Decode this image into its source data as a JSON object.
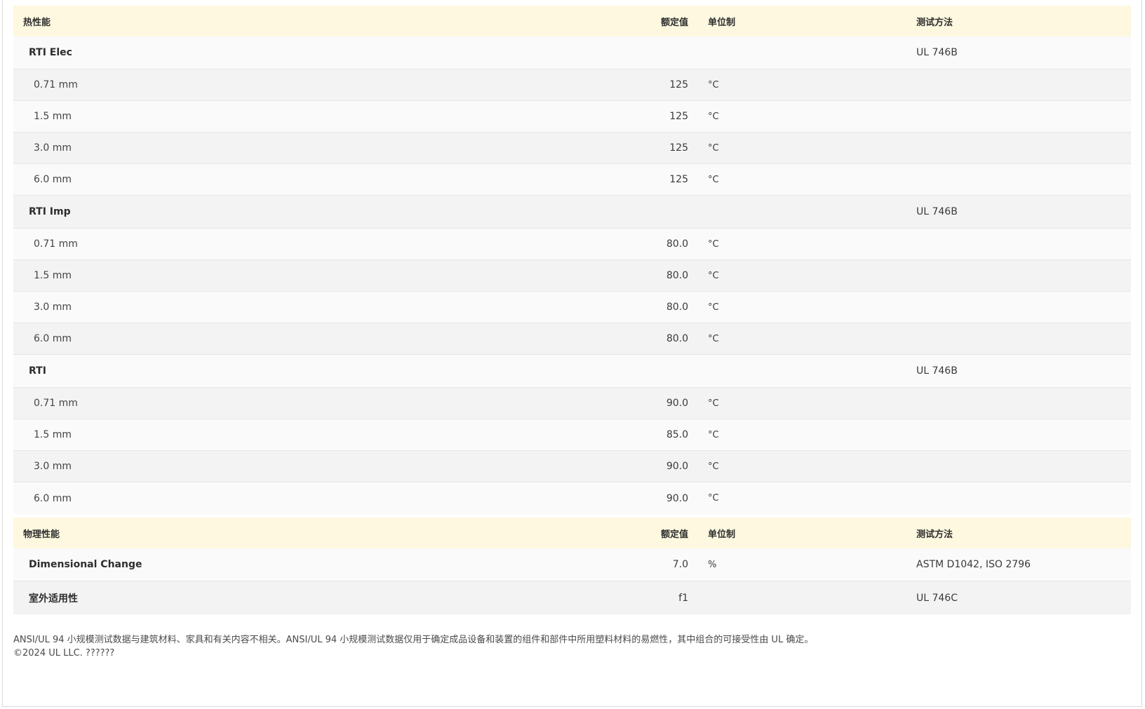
{
  "thermal": {
    "header": {
      "name": "热性能",
      "value": "额定值",
      "unit": "单位制",
      "method": "测试方法"
    },
    "rows": [
      {
        "kind": "group",
        "name": "RTI Elec",
        "value": "",
        "unit": "",
        "method": "UL 746B"
      },
      {
        "kind": "sub",
        "name": "0.71 mm",
        "value": "125",
        "unit": "°C",
        "method": ""
      },
      {
        "kind": "sub",
        "name": "1.5 mm",
        "value": "125",
        "unit": "°C",
        "method": ""
      },
      {
        "kind": "sub",
        "name": "3.0 mm",
        "value": "125",
        "unit": "°C",
        "method": ""
      },
      {
        "kind": "sub",
        "name": "6.0 mm",
        "value": "125",
        "unit": "°C",
        "method": ""
      },
      {
        "kind": "group",
        "name": "RTI Imp",
        "value": "",
        "unit": "",
        "method": "UL 746B"
      },
      {
        "kind": "sub",
        "name": "0.71 mm",
        "value": "80.0",
        "unit": "°C",
        "method": ""
      },
      {
        "kind": "sub",
        "name": "1.5 mm",
        "value": "80.0",
        "unit": "°C",
        "method": ""
      },
      {
        "kind": "sub",
        "name": "3.0 mm",
        "value": "80.0",
        "unit": "°C",
        "method": ""
      },
      {
        "kind": "sub",
        "name": "6.0 mm",
        "value": "80.0",
        "unit": "°C",
        "method": ""
      },
      {
        "kind": "group",
        "name": "RTI",
        "value": "",
        "unit": "",
        "method": "UL 746B"
      },
      {
        "kind": "sub",
        "name": "0.71 mm",
        "value": "90.0",
        "unit": "°C",
        "method": ""
      },
      {
        "kind": "sub",
        "name": "1.5 mm",
        "value": "85.0",
        "unit": "°C",
        "method": ""
      },
      {
        "kind": "sub",
        "name": "3.0 mm",
        "value": "90.0",
        "unit": "°C",
        "method": ""
      },
      {
        "kind": "sub",
        "name": "6.0 mm",
        "value": "90.0",
        "unit": "°C",
        "method": ""
      }
    ]
  },
  "physical": {
    "header": {
      "name": "物理性能",
      "value": "额定值",
      "unit": "单位制",
      "method": "测试方法"
    },
    "rows": [
      {
        "kind": "group",
        "name": "Dimensional Change",
        "value": "7.0",
        "unit": "%",
        "method": "ASTM D1042, ISO 2796"
      },
      {
        "kind": "group",
        "name": "室外适用性",
        "value": "f1",
        "unit": "",
        "method": "UL 746C"
      }
    ]
  },
  "footer": {
    "disclaimer": "ANSI/UL 94 小规模测试数据与建筑材料、家具和有关内容不相关。ANSI/UL 94 小规模测试数据仅用于确定成品设备和装置的组件和部件中所用塑料材料的易燃性，其中组合的可接受性由 UL 确定。",
    "copyright": "©2024 UL LLC. ??????"
  }
}
